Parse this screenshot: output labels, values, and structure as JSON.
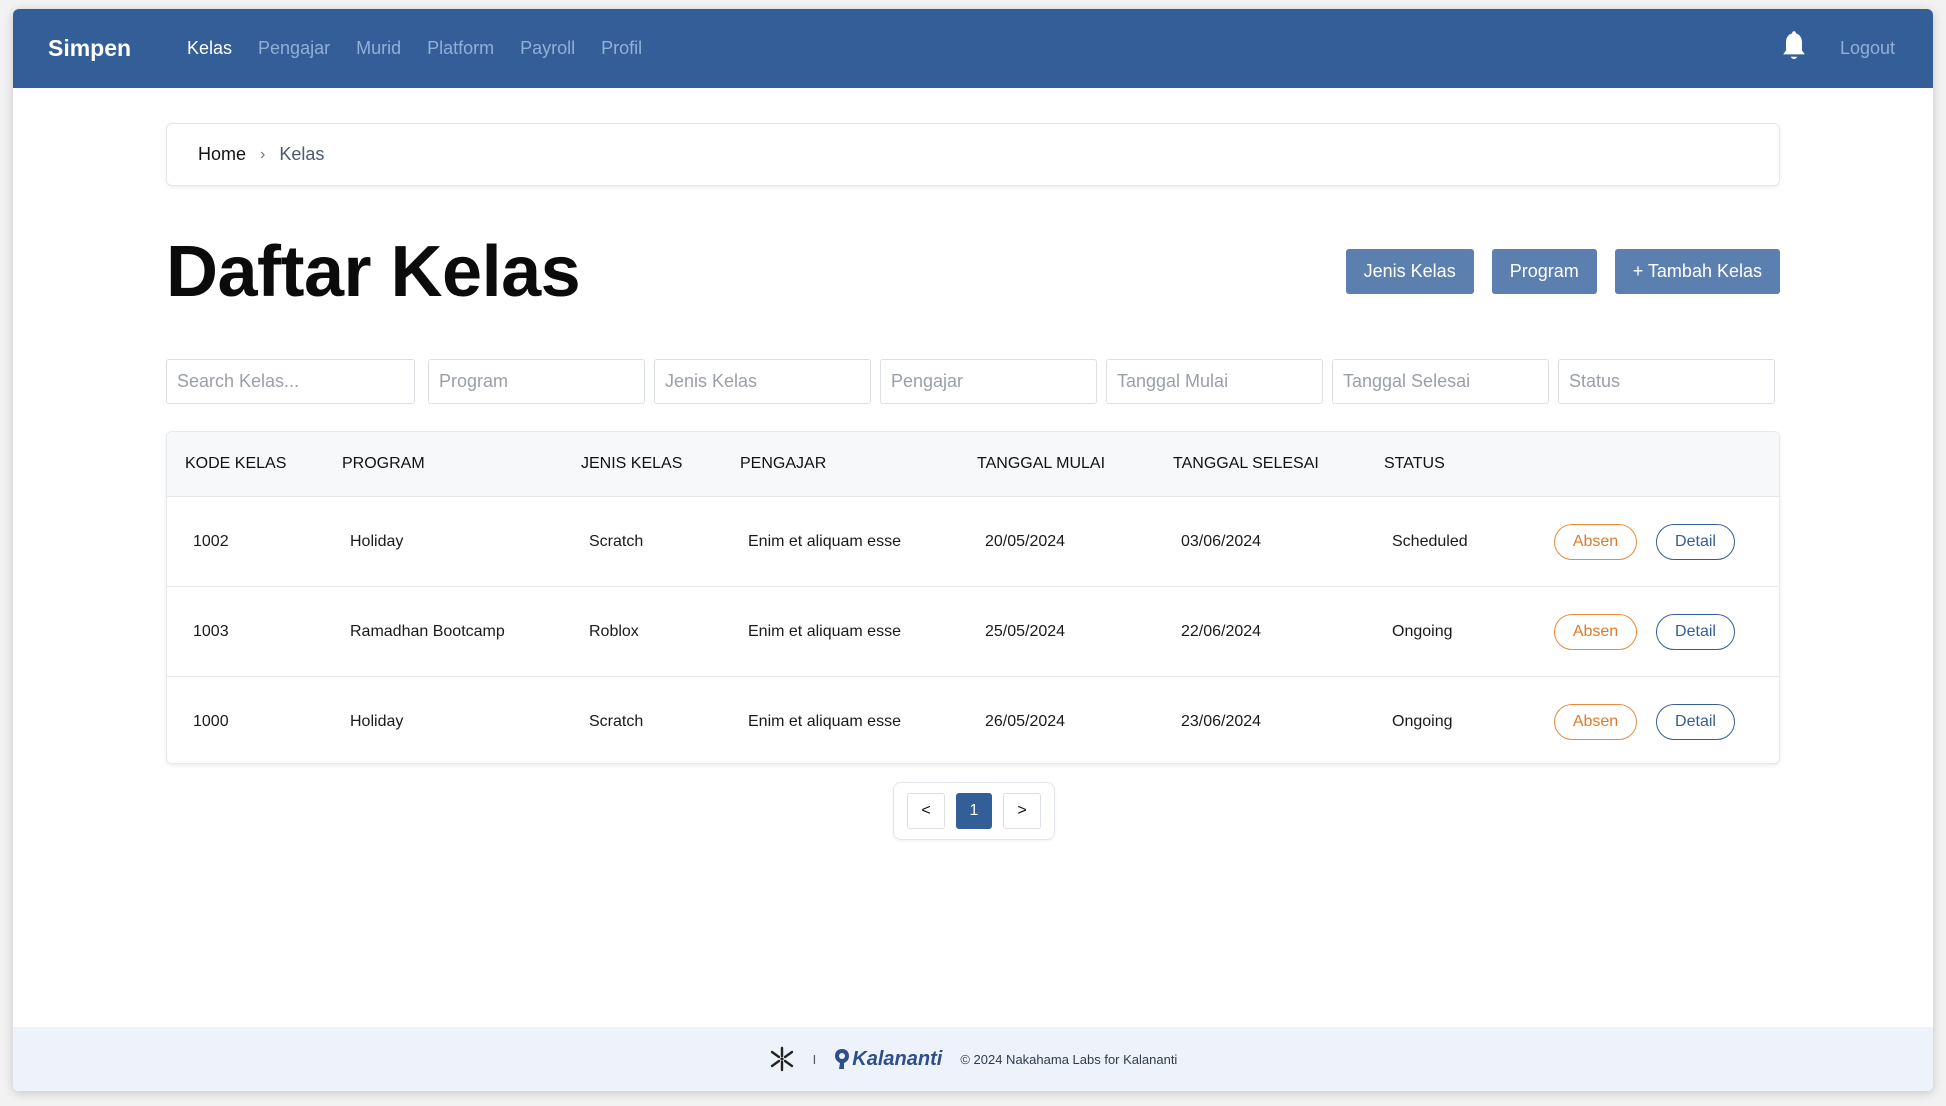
{
  "navbar": {
    "brand": "Simpen",
    "links": [
      "Kelas",
      "Pengajar",
      "Murid",
      "Platform",
      "Payroll",
      "Profil"
    ],
    "active_link": "Kelas",
    "logout": "Logout",
    "bell_icon": "bell-icon"
  },
  "breadcrumb": {
    "home": "Home",
    "separator": "›",
    "current": "Kelas"
  },
  "page": {
    "title": "Daftar Kelas"
  },
  "actions": {
    "jenis_kelas": "Jenis Kelas",
    "program": "Program",
    "tambah_kelas": "+ Tambah Kelas"
  },
  "filters": {
    "search": "Search Kelas...",
    "program": "Program",
    "jenis_kelas": "Jenis Kelas",
    "pengajar": "Pengajar",
    "tanggal_mulai": "Tanggal Mulai",
    "tanggal_selesai": "Tanggal Selesai",
    "status": "Status"
  },
  "table": {
    "headers": [
      "KODE KELAS",
      "PROGRAM",
      "JENIS KELAS",
      "PENGAJAR",
      "TANGGAL MULAI",
      "TANGGAL SELESAI",
      "STATUS"
    ],
    "rows": [
      {
        "kode": "1002",
        "program": "Holiday",
        "jenis": "Scratch",
        "pengajar": "Enim et aliquam esse",
        "mulai": "20/05/2024",
        "selesai": "03/06/2024",
        "status": "Scheduled"
      },
      {
        "kode": "1003",
        "program": "Ramadhan Bootcamp",
        "jenis": "Roblox",
        "pengajar": "Enim et aliquam esse",
        "mulai": "25/05/2024",
        "selesai": "22/06/2024",
        "status": "Ongoing"
      },
      {
        "kode": "1000",
        "program": "Holiday",
        "jenis": "Scratch",
        "pengajar": "Enim et aliquam esse",
        "mulai": "26/05/2024",
        "selesai": "23/06/2024",
        "status": "Ongoing"
      }
    ],
    "absen_label": "Absen",
    "detail_label": "Detail"
  },
  "pagination": {
    "prev": "<",
    "current": "1",
    "next": ">"
  },
  "footer": {
    "brand": "Kalananti",
    "divider": "I",
    "copyright": "© 2024 Nakahama Labs for Kalananti"
  },
  "colors": {
    "primary": "#335e98",
    "button": "#5b7fae",
    "absen": "#e07a2a",
    "footer_bg": "#eef3fb"
  }
}
